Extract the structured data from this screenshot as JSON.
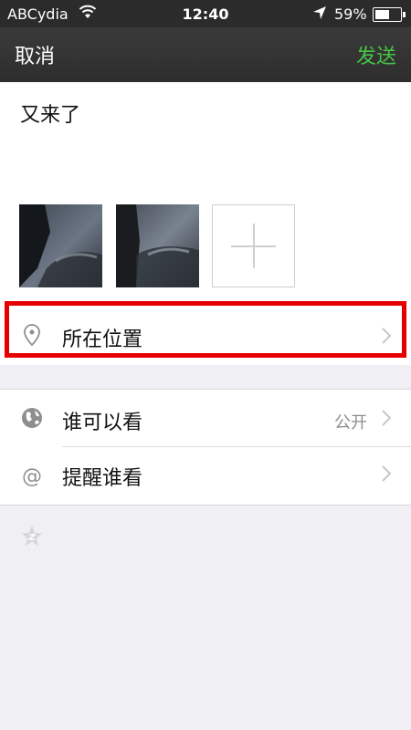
{
  "status_bar": {
    "carrier": "ABCydia",
    "time": "12:40",
    "battery": "59%",
    "battery_level": 0.59
  },
  "nav": {
    "cancel": "取消",
    "send": "发送",
    "send_color": "#46c346"
  },
  "compose": {
    "text": "又来了",
    "photo_count": 2
  },
  "location": {
    "label": "所在位置",
    "highlight_color": "#e60000"
  },
  "visibility": {
    "label": "谁可以看",
    "value": "公开"
  },
  "remind": {
    "label": "提醒谁看"
  },
  "icons": [
    "wifi-icon",
    "location-arrow-icon",
    "battery-icon",
    "location-pin-icon",
    "chevron-right-icon",
    "globe-icon",
    "at-icon",
    "star-icon",
    "plus-icon"
  ]
}
